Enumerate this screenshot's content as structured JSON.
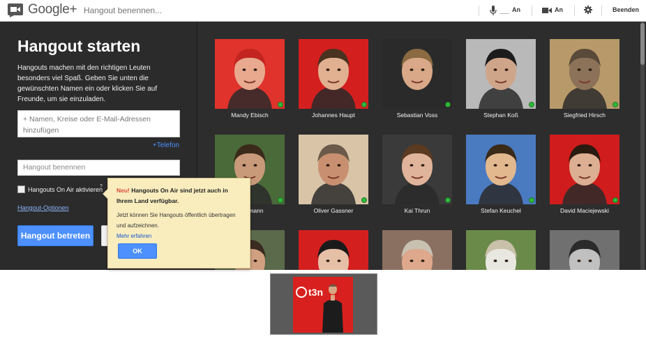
{
  "topbar": {
    "logo_text": "Google+",
    "name_placeholder": "Hangout benennen...",
    "mic_state": "An",
    "camera_state": "An",
    "end_label": "Beenden"
  },
  "left": {
    "title": "Hangout starten",
    "description": "Hangouts machen mit den richtigen Leuten besonders viel Spaß. Geben Sie unten die gewünschten Namen ein oder klicken Sie auf Freunde, um sie einzuladen.",
    "people_placeholder": "+ Namen, Kreise oder E-Mail-Adressen hinzufügen",
    "phone_link": "+Telefon",
    "name_placeholder": "Hangout benennen",
    "onair_label": "Hangouts On Air aktivieren",
    "onair_help": "?",
    "options_link": "Hangout-Optionen",
    "join_button": "Hangout betreten"
  },
  "tooltip": {
    "new_label": "Neu!",
    "headline": "Hangouts On Air sind jetzt auch in Ihrem Land verfügbar.",
    "body": "Jetzt können Sie Hangouts öffentlich übertragen und aufzeichnen.",
    "link": "Mehr erfahren",
    "ok": "OK"
  },
  "people": [
    {
      "name": "Mandy Ebisch",
      "bg": "#e0332c",
      "skin": "#e8a98f",
      "hair": "#c2251f",
      "online": true
    },
    {
      "name": "Johannes Haupt",
      "bg": "#d41f1f",
      "skin": "#e0b090",
      "hair": "#4a3220",
      "online": true
    },
    {
      "name": "Sebastian Voss",
      "bg": "#2a2a2a",
      "skin": "#d8a888",
      "hair": "#8a6a40",
      "online": true
    },
    {
      "name": "Stephan Koß",
      "bg": "#b9b9b9",
      "skin": "#cfa58a",
      "hair": "#1c1c1c",
      "online": true
    },
    {
      "name": "Siegfried Hirsch",
      "bg": "#b89a6a",
      "skin": "#8c7258",
      "hair": "#5a4a3a",
      "online": true
    },
    {
      "name": "…ehmann",
      "bg": "#4a6a3a",
      "skin": "#c89a7a",
      "hair": "#3a2a1a",
      "online": true
    },
    {
      "name": "Oliver Gassner",
      "bg": "#d9c4a8",
      "skin": "#c89070",
      "hair": "#6a5a4a",
      "online": true
    },
    {
      "name": "Kai Thrun",
      "bg": "#3a3a3a",
      "skin": "#e0b49a",
      "hair": "#5a3a20",
      "online": true
    },
    {
      "name": "Stefan Keuchel",
      "bg": "#4a7ac0",
      "skin": "#e2b88e",
      "hair": "#3a2a1a",
      "online": true
    },
    {
      "name": "David Maciejewski",
      "bg": "#d01c1c",
      "skin": "#dcae92",
      "hair": "#2a1a10",
      "online": true
    },
    {
      "name": "",
      "bg": "#5a6a4a",
      "skin": "#d0a080",
      "hair": "#3a2a20",
      "online": false
    },
    {
      "name": "",
      "bg": "#d41f1f",
      "skin": "#e6c0a6",
      "hair": "#1a1a1a",
      "online": false
    },
    {
      "name": "",
      "bg": "#8a7060",
      "skin": "#dda88c",
      "hair": "#c8c0b0",
      "online": false
    },
    {
      "name": "",
      "bg": "#6a8a4a",
      "skin": "#e8e8e0",
      "hair": "#c8c0a8",
      "online": false
    },
    {
      "name": "",
      "bg": "#707070",
      "skin": "#c0c0c0",
      "hair": "#2a2a2a",
      "online": false
    }
  ],
  "preview": {
    "logo": "t3n"
  }
}
